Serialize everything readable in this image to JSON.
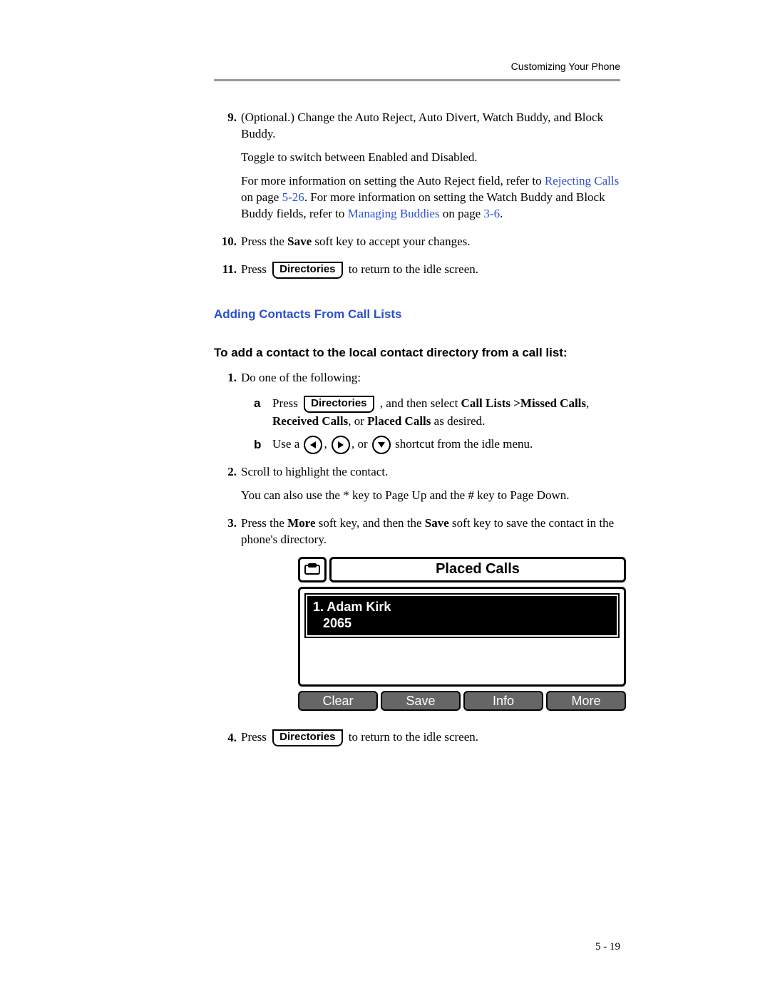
{
  "header": "Customizing Your Phone",
  "page_number": "5 - 19",
  "dir_key_label": "Directories",
  "section_heading": "Adding Contacts From Call Lists",
  "subheading": "To add a contact to the local contact directory from a call list:",
  "step9": {
    "num": "9.",
    "p1": "(Optional.) Change the Auto Reject, Auto Divert, Watch Buddy, and Block Buddy.",
    "p2": "Toggle to switch between Enabled and Disabled.",
    "p3a": "For more information on setting the Auto Reject field, refer to ",
    "link1": "Rejecting Calls",
    "p3b": " on page ",
    "pg1": "5-26",
    "p3c": ". For more information on setting the Watch Buddy and Block Buddy fields, refer to ",
    "link2": "Managing Buddies",
    "p3d": " on page ",
    "pg2": "3-6",
    "p3e": "."
  },
  "step10": {
    "num": "10.",
    "pre": "Press the ",
    "bold": "Save",
    "post": " soft key to accept your changes."
  },
  "step11": {
    "num": "11.",
    "pre": "Press ",
    "post": " to return to the idle screen."
  },
  "s1": {
    "num": "1.",
    "text": "Do one of the following:",
    "a": {
      "letter": "a",
      "pre": "Press ",
      "mid": " , and then select ",
      "b1": "Call Lists >Missed Calls",
      "sep1": ", ",
      "b2": "Received Calls",
      "sep2": ", or ",
      "b3": "Placed Calls",
      "post": " as desired."
    },
    "b": {
      "letter": "b",
      "pre": "Use a ",
      "sep": ", ",
      "or": ", or ",
      "post": " shortcut from the idle menu."
    }
  },
  "s2": {
    "num": "2.",
    "p1": "Scroll to highlight the contact.",
    "p2": "You can also use the * key to Page Up and the # key to Page Down."
  },
  "s3": {
    "num": "3.",
    "pre": "Press the ",
    "b1": "More",
    "mid": " soft key, and then the ",
    "b2": "Save",
    "post": " soft key to save the contact in the phone's directory."
  },
  "s4": {
    "num": "4.",
    "pre": "Press ",
    "post": " to return to the idle screen."
  },
  "phone": {
    "title": "Placed Calls",
    "entry_line1": "1. Adam Kirk",
    "entry_line2": "2065",
    "soft": [
      "Clear",
      "Save",
      "Info",
      "More"
    ]
  }
}
